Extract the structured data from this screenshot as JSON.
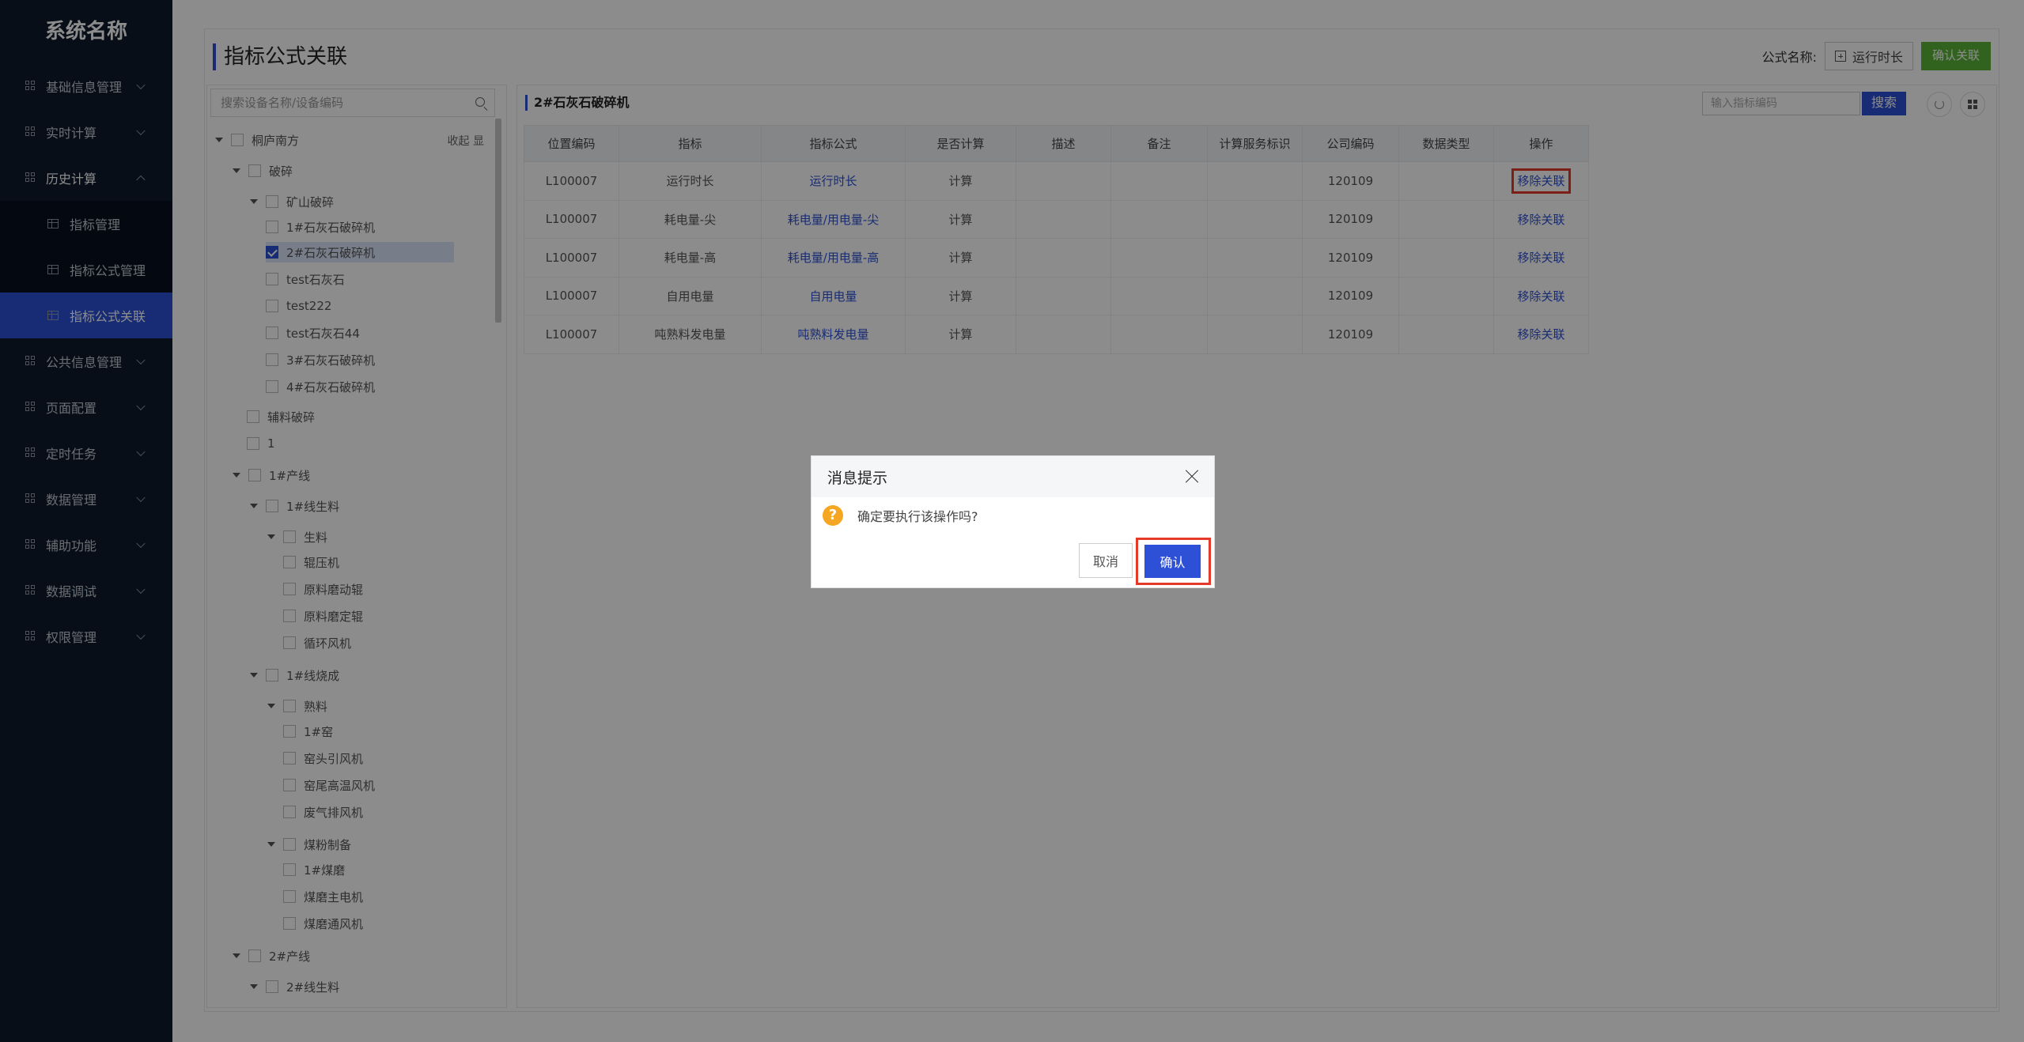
{
  "sidebar": {
    "logo": "系统名称",
    "items": [
      {
        "label": "基础信息管理"
      },
      {
        "label": "实时计算"
      },
      {
        "label": "历史计算"
      },
      {
        "label": "公共信息管理"
      },
      {
        "label": "页面配置"
      },
      {
        "label": "定时任务"
      },
      {
        "label": "数据管理"
      },
      {
        "label": "辅助功能"
      },
      {
        "label": "数据调试"
      },
      {
        "label": "权限管理"
      }
    ],
    "sub_items": [
      {
        "label": "指标管理"
      },
      {
        "label": "指标公式管理"
      },
      {
        "label": "指标公式关联"
      }
    ]
  },
  "page": {
    "title": "指标公式关联",
    "formula_label": "公式名称:",
    "formula_value": "运行时长",
    "confirm_link_button": "确认关联"
  },
  "tree": {
    "search_placeholder": "搜索设备名称/设备编码",
    "collapse_all": "收起 显",
    "nodes": [
      {
        "label": "桐庐南方"
      },
      {
        "label": "破碎"
      },
      {
        "label": "矿山破碎"
      },
      {
        "label": "1#石灰石破碎机"
      },
      {
        "label": "2#石灰石破碎机"
      },
      {
        "label": "test石灰石"
      },
      {
        "label": "test222"
      },
      {
        "label": "test石灰石44"
      },
      {
        "label": "3#石灰石破碎机"
      },
      {
        "label": "4#石灰石破碎机"
      },
      {
        "label": "辅料破碎"
      },
      {
        "label": "1"
      },
      {
        "label": "1#产线"
      },
      {
        "label": "1#线生料"
      },
      {
        "label": "生料"
      },
      {
        "label": "辊压机"
      },
      {
        "label": "原料磨动辊"
      },
      {
        "label": "原料磨定辊"
      },
      {
        "label": "循环风机"
      },
      {
        "label": "1#线烧成"
      },
      {
        "label": "熟料"
      },
      {
        "label": "1#窑"
      },
      {
        "label": "窑头引风机"
      },
      {
        "label": "窑尾高温风机"
      },
      {
        "label": "废气排风机"
      },
      {
        "label": "煤粉制备"
      },
      {
        "label": "1#煤磨"
      },
      {
        "label": "煤磨主电机"
      },
      {
        "label": "煤磨通风机"
      },
      {
        "label": "2#产线"
      },
      {
        "label": "2#线生料"
      }
    ]
  },
  "right": {
    "title": "2#石灰石破碎机",
    "search_placeholder": "输入指标编码",
    "search_button": "搜索",
    "refresh_icon": "refresh-icon",
    "layout_icon": "grid-icon"
  },
  "table": {
    "headers": [
      "位置编码",
      "指标",
      "指标公式",
      "是否计算",
      "描述",
      "备注",
      "计算服务标识",
      "公司编码",
      "数据类型",
      "操作"
    ],
    "rows": [
      {
        "loc": "L100007",
        "metric": "运行时长",
        "formula": "运行时长",
        "calc": "计算",
        "desc": "",
        "note": "",
        "svc": "",
        "company": "120109",
        "dtype": "",
        "op": "移除关联"
      },
      {
        "loc": "L100007",
        "metric": "耗电量-尖",
        "formula": "耗电量/用电量-尖",
        "calc": "计算",
        "desc": "",
        "note": "",
        "svc": "",
        "company": "120109",
        "dtype": "",
        "op": "移除关联"
      },
      {
        "loc": "L100007",
        "metric": "耗电量-高",
        "formula": "耗电量/用电量-高",
        "calc": "计算",
        "desc": "",
        "note": "",
        "svc": "",
        "company": "120109",
        "dtype": "",
        "op": "移除关联"
      },
      {
        "loc": "L100007",
        "metric": "自用电量",
        "formula": "自用电量",
        "calc": "计算",
        "desc": "",
        "note": "",
        "svc": "",
        "company": "120109",
        "dtype": "",
        "op": "移除关联"
      },
      {
        "loc": "L100007",
        "metric": "吨熟料发电量",
        "formula": "吨熟料发电量",
        "calc": "计算",
        "desc": "",
        "note": "",
        "svc": "",
        "company": "120109",
        "dtype": "",
        "op": "移除关联"
      }
    ]
  },
  "dialog": {
    "title": "消息提示",
    "message": "确定要执行该操作吗?",
    "cancel": "取消",
    "confirm": "确认"
  },
  "colors": {
    "sidebar_bg": "#0e1a2b",
    "accent": "#2d50d6",
    "green": "#5ab43a",
    "highlight_red": "#e53a2a",
    "warning": "#f5a623"
  }
}
